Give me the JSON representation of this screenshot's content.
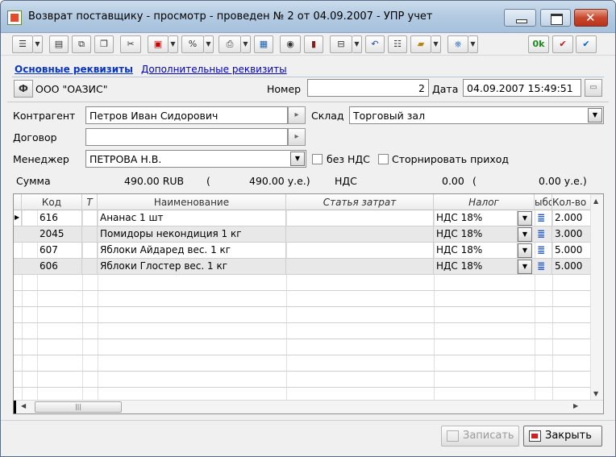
{
  "window": {
    "title": "Возврат поставщику - просмотр - проведен № 2 от 04.09.2007 - УПР учет"
  },
  "toolbar": {
    "ok_label": "0k"
  },
  "tabs": [
    "Основные реквизиты",
    "Дополнительные реквизиты"
  ],
  "header": {
    "org": "ООО \"ОАЗИС\"",
    "org_badge": "Ф",
    "number_label": "Номер",
    "number_value": "2",
    "date_label": "Дата",
    "date_value": "04.09.2007 15:49:51"
  },
  "form": {
    "counterparty_label": "Контрагент",
    "counterparty_value": "Петров Иван Сидорович",
    "warehouse_label": "Склад",
    "warehouse_value": "Торговый зал",
    "contract_label": "Договор",
    "contract_value": "",
    "manager_label": "Менеджер",
    "manager_value": "ПЕТРОВА Н.В.",
    "no_vat_label": "без НДС",
    "storno_label": "Сторнировать приход"
  },
  "totals": {
    "sum_label": "Сумма",
    "sum_value": "490.00 RUB",
    "open1": "(",
    "sum_ue": "490.00 у.е.)",
    "vat_label": "НДС",
    "vat_value": "0.00",
    "open2": "(",
    "vat_ue": "0.00 у.е.)"
  },
  "grid": {
    "columns": [
      "Код",
      "Т",
      "Наименование",
      "Статья затрат",
      "Налог",
      "ыбо",
      "Кол-во"
    ],
    "rows": [
      {
        "code": "616",
        "t": "",
        "name": "Ананас 1 шт",
        "cost": "",
        "tax": "НДС 18%",
        "qty": "2.000"
      },
      {
        "code": "2045",
        "t": "",
        "name": "Помидоры некондиция 1 кг",
        "cost": "",
        "tax": "НДС 18%",
        "qty": "3.000"
      },
      {
        "code": "607",
        "t": "",
        "name": "Яблоки Айдаред вес. 1 кг",
        "cost": "",
        "tax": "НДС 18%",
        "qty": "5.000"
      },
      {
        "code": "606",
        "t": "",
        "name": "Яблоки Глостер вес. 1 кг",
        "cost": "",
        "tax": "НДС 18%",
        "qty": "5.000"
      }
    ]
  },
  "buttons": {
    "save": "Записать",
    "close": "Закрыть"
  }
}
